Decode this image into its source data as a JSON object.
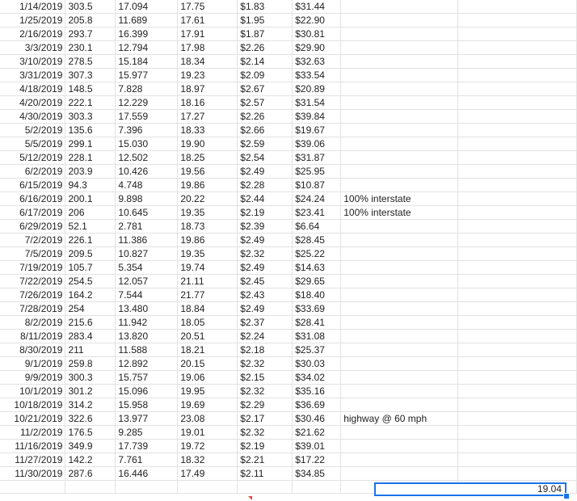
{
  "rows": [
    {
      "date": "1/14/2019",
      "miles": "303.5",
      "gallons": "17.094",
      "mpg": "17.75",
      "price": "$1.83",
      "cost": "$31.44",
      "note": ""
    },
    {
      "date": "1/25/2019",
      "miles": "205.8",
      "gallons": "11.689",
      "mpg": "17.61",
      "price": "$1.95",
      "cost": "$22.90",
      "note": ""
    },
    {
      "date": "2/16/2019",
      "miles": "293.7",
      "gallons": "16.399",
      "mpg": "17.91",
      "price": "$1.87",
      "cost": "$30.81",
      "note": ""
    },
    {
      "date": "3/3/2019",
      "miles": "230.1",
      "gallons": "12.794",
      "mpg": "17.98",
      "price": "$2.26",
      "cost": "$29.90",
      "note": ""
    },
    {
      "date": "3/10/2019",
      "miles": "278.5",
      "gallons": "15.184",
      "mpg": "18.34",
      "price": "$2.14",
      "cost": "$32.63",
      "note": ""
    },
    {
      "date": "3/31/2019",
      "miles": "307.3",
      "gallons": "15.977",
      "mpg": "19.23",
      "price": "$2.09",
      "cost": "$33.54",
      "note": ""
    },
    {
      "date": "4/18/2019",
      "miles": "148.5",
      "gallons": "7.828",
      "mpg": "18.97",
      "price": "$2.67",
      "cost": "$20.89",
      "note": ""
    },
    {
      "date": "4/20/2019",
      "miles": "222.1",
      "gallons": "12.229",
      "mpg": "18.16",
      "price": "$2.57",
      "cost": "$31.54",
      "note": ""
    },
    {
      "date": "4/30/2019",
      "miles": "303.3",
      "gallons": "17.559",
      "mpg": "17.27",
      "price": "$2.26",
      "cost": "$39.84",
      "note": ""
    },
    {
      "date": "5/2/2019",
      "miles": "135.6",
      "gallons": "7.396",
      "mpg": "18.33",
      "price": "$2.66",
      "cost": "$19.67",
      "note": ""
    },
    {
      "date": "5/5/2019",
      "miles": "299.1",
      "gallons": "15.030",
      "mpg": "19.90",
      "price": "$2.59",
      "cost": "$39.06",
      "note": ""
    },
    {
      "date": "5/12/2019",
      "miles": "228.1",
      "gallons": "12.502",
      "mpg": "18.25",
      "price": "$2.54",
      "cost": "$31.87",
      "note": ""
    },
    {
      "date": "6/2/2019",
      "miles": "203.9",
      "gallons": "10.426",
      "mpg": "19.56",
      "price": "$2.49",
      "cost": "$25.95",
      "note": ""
    },
    {
      "date": "6/15/2019",
      "miles": "94.3",
      "gallons": "4.748",
      "mpg": "19.86",
      "price": "$2.28",
      "cost": "$10.87",
      "note": ""
    },
    {
      "date": "6/16/2019",
      "miles": "200.1",
      "gallons": "9.898",
      "mpg": "20.22",
      "price": "$2.44",
      "cost": "$24.24",
      "note": "100% interstate"
    },
    {
      "date": "6/17/2019",
      "miles": "206",
      "gallons": "10.645",
      "mpg": "19.35",
      "price": "$2.19",
      "cost": "$23.41",
      "note": "100% interstate"
    },
    {
      "date": "6/29/2019",
      "miles": "52.1",
      "gallons": "2.781",
      "mpg": "18.73",
      "price": "$2.39",
      "cost": "$6.64",
      "note": ""
    },
    {
      "date": "7/2/2019",
      "miles": "226.1",
      "gallons": "11.386",
      "mpg": "19.86",
      "price": "$2.49",
      "cost": "$28.45",
      "note": ""
    },
    {
      "date": "7/5/2019",
      "miles": "209.5",
      "gallons": "10.827",
      "mpg": "19.35",
      "price": "$2.32",
      "cost": "$25.22",
      "note": ""
    },
    {
      "date": "7/19/2019",
      "miles": "105.7",
      "gallons": "5.354",
      "mpg": "19.74",
      "price": "$2.49",
      "cost": "$14.63",
      "note": ""
    },
    {
      "date": "7/22/2019",
      "miles": "254.5",
      "gallons": "12.057",
      "mpg": "21.11",
      "price": "$2.45",
      "cost": "$29.65",
      "note": ""
    },
    {
      "date": "7/26/2019",
      "miles": "164.2",
      "gallons": "7.544",
      "mpg": "21.77",
      "price": "$2.43",
      "cost": "$18.40",
      "note": ""
    },
    {
      "date": "7/28/2019",
      "miles": "254",
      "gallons": "13.480",
      "mpg": "18.84",
      "price": "$2.49",
      "cost": "$33.69",
      "note": ""
    },
    {
      "date": "8/2/2019",
      "miles": "215.6",
      "gallons": "11.942",
      "mpg": "18.05",
      "price": "$2.37",
      "cost": "$28.41",
      "note": ""
    },
    {
      "date": "8/11/2019",
      "miles": "283.4",
      "gallons": "13.820",
      "mpg": "20.51",
      "price": "$2.24",
      "cost": "$31.08",
      "note": ""
    },
    {
      "date": "8/30/2019",
      "miles": "211",
      "gallons": "11.588",
      "mpg": "18.21",
      "price": "$2.18",
      "cost": "$25.37",
      "note": ""
    },
    {
      "date": "9/1/2019",
      "miles": "259.8",
      "gallons": "12.892",
      "mpg": "20.15",
      "price": "$2.32",
      "cost": "$30.03",
      "note": ""
    },
    {
      "date": "9/9/2019",
      "miles": "300.3",
      "gallons": "15.757",
      "mpg": "19.06",
      "price": "$2.15",
      "cost": "$34.02",
      "note": ""
    },
    {
      "date": "10/1/2019",
      "miles": "301.2",
      "gallons": "15.096",
      "mpg": "19.95",
      "price": "$2.32",
      "cost": "$35.16",
      "note": ""
    },
    {
      "date": "10/18/2019",
      "miles": "314.2",
      "gallons": "15.958",
      "mpg": "19.69",
      "price": "$2.29",
      "cost": "$36.69",
      "note": ""
    },
    {
      "date": "10/21/2019",
      "miles": "322.6",
      "gallons": "13.977",
      "mpg": "23.08",
      "price": "$2.17",
      "cost": "$30.46",
      "note": "highway @ 60 mph"
    },
    {
      "date": "11/2/2019",
      "miles": "176.5",
      "gallons": "9.285",
      "mpg": "19.01",
      "price": "$2.32",
      "cost": "$21.62",
      "note": ""
    },
    {
      "date": "11/16/2019",
      "miles": "349.9",
      "gallons": "17.739",
      "mpg": "19.72",
      "price": "$2.19",
      "cost": "$39.01",
      "note": ""
    },
    {
      "date": "11/27/2019",
      "miles": "142.2",
      "gallons": "7.761",
      "mpg": "18.32",
      "price": "$2.21",
      "cost": "$17.22",
      "note": ""
    },
    {
      "date": "11/30/2019",
      "miles": "287.6",
      "gallons": "16.446",
      "mpg": "17.49",
      "price": "$2.11",
      "cost": "$34.85",
      "note": ""
    }
  ],
  "active_cell": {
    "value": "19.04"
  },
  "colors": {
    "selection": "#1a73e8",
    "gridline": "#e2e2e2",
    "text": "#222222"
  }
}
